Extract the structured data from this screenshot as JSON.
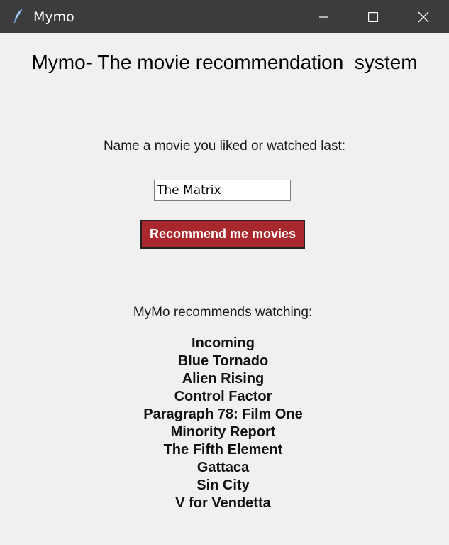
{
  "window": {
    "title": "Mymo",
    "icon": "feather-icon"
  },
  "main": {
    "heading": "Mymo- The movie recommendation  system",
    "prompt": "Name a movie you liked or watched last:",
    "input_value": "The Matrix",
    "button_label": "Recommend me movies",
    "recommend_label": "MyMo recommends watching:",
    "recommendations": [
      "Incoming",
      "Blue Tornado",
      "Alien Rising",
      "Control Factor",
      "Paragraph 78: Film One",
      "Minority Report",
      "The Fifth Element",
      "Gattaca",
      "Sin City",
      "V for Vendetta"
    ]
  },
  "colors": {
    "titlebar": "#3c3c3c",
    "button": "#a8282d",
    "background": "#f0f0f0"
  }
}
